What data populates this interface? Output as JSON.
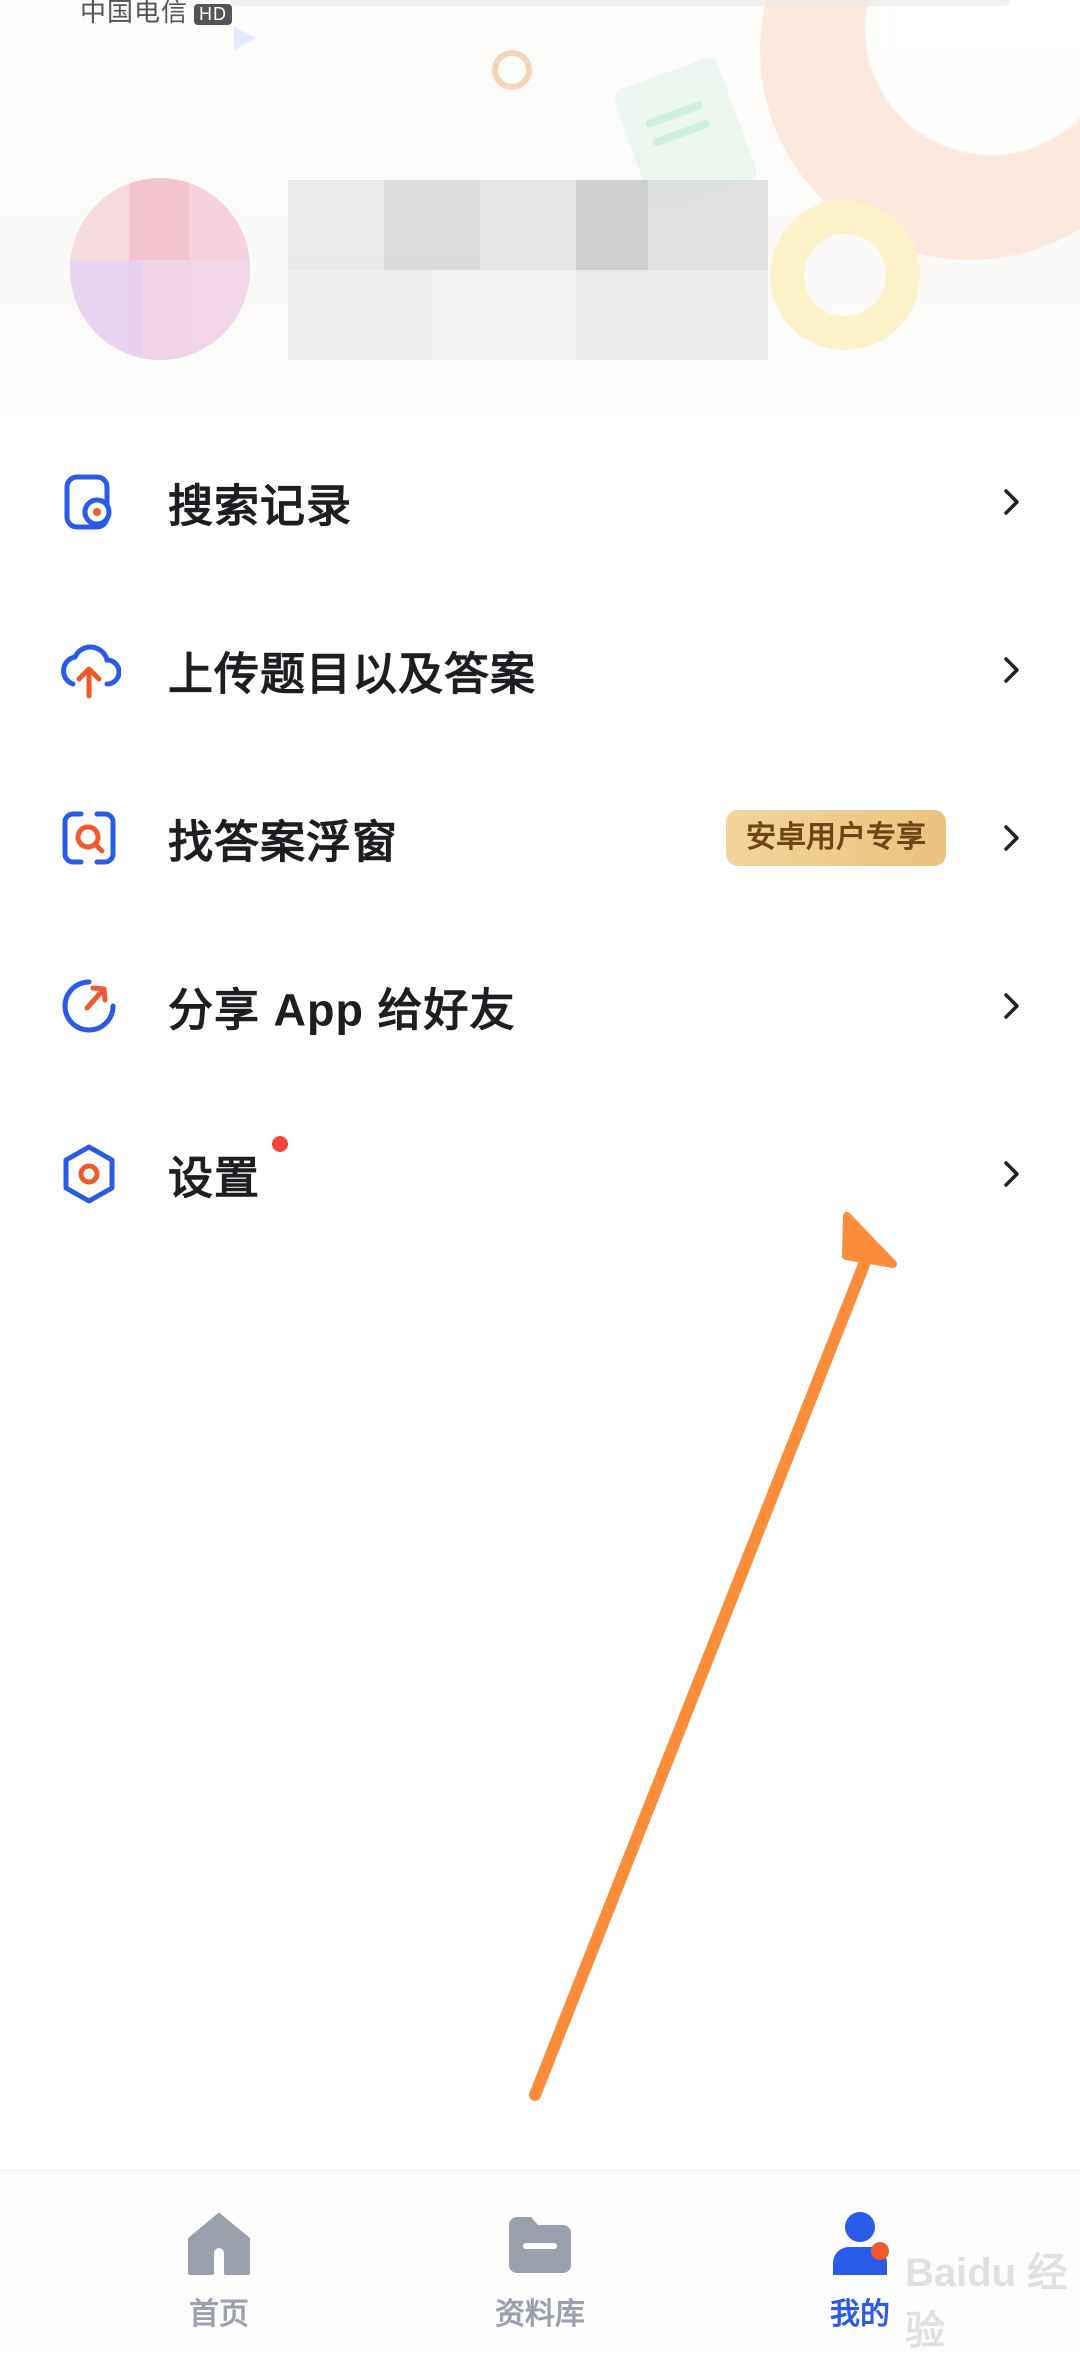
{
  "status_bar": {
    "carrier": "中国电信",
    "hd_badge": "HD"
  },
  "profile": {
    "avatar": "avatar-blurred",
    "name": ""
  },
  "menu": {
    "items": [
      {
        "label": "搜索记录",
        "icon": "search-history-icon"
      },
      {
        "label": "上传题目以及答案",
        "icon": "upload-cloud-icon"
      },
      {
        "label": "找答案浮窗",
        "icon": "floating-window-search-icon",
        "badge": "安卓用户专享"
      },
      {
        "label": "分享 App 给好友",
        "icon": "share-icon"
      },
      {
        "label": "设置",
        "icon": "settings-icon",
        "has_red_dot": true
      }
    ]
  },
  "tabbar": {
    "tabs": [
      {
        "label": "首页",
        "icon": "home-icon",
        "active": false
      },
      {
        "label": "资料库",
        "icon": "folder-icon",
        "active": false
      },
      {
        "label": "我的",
        "icon": "profile-icon",
        "active": true
      }
    ]
  },
  "watermark": "Baidu 经验",
  "colors": {
    "accent": "#2a5ae8",
    "icon_orange": "#f0592b",
    "badge_bg": "#efcb8c",
    "badge_text": "#6e4514",
    "red_dot": "#f2483b",
    "annotation_arrow": "#fb8c3a",
    "tab_inactive": "#9aa1ad"
  }
}
